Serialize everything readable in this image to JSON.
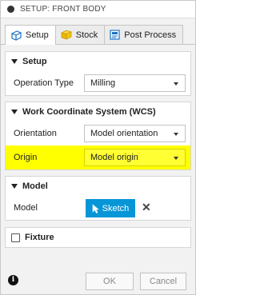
{
  "title": "SETUP: FRONT BODY",
  "tabs": [
    {
      "label": "Setup",
      "icon": "setup-icon",
      "active": true
    },
    {
      "label": "Stock",
      "icon": "stock-icon",
      "active": false
    },
    {
      "label": "Post Process",
      "icon": "post-process-icon",
      "active": false
    }
  ],
  "setup_section": {
    "heading": "Setup",
    "operation_type": {
      "label": "Operation Type",
      "value": "Milling"
    }
  },
  "wcs_section": {
    "heading": "Work Coordinate System (WCS)",
    "orientation": {
      "label": "Orientation",
      "value": "Model orientation"
    },
    "origin": {
      "label": "Origin",
      "value": "Model origin",
      "highlight_color": "#ffff00"
    }
  },
  "model_section": {
    "heading": "Model",
    "model": {
      "label": "Model",
      "button_label": "Sketch",
      "clear_symbol": "✕"
    }
  },
  "fixture_section": {
    "label": "Fixture",
    "checked": false
  },
  "footer": {
    "info_symbol": "i",
    "ok_label": "OK",
    "cancel_label": "Cancel"
  },
  "colors": {
    "accent": "#0696d7",
    "highlight": "#ffff00"
  }
}
